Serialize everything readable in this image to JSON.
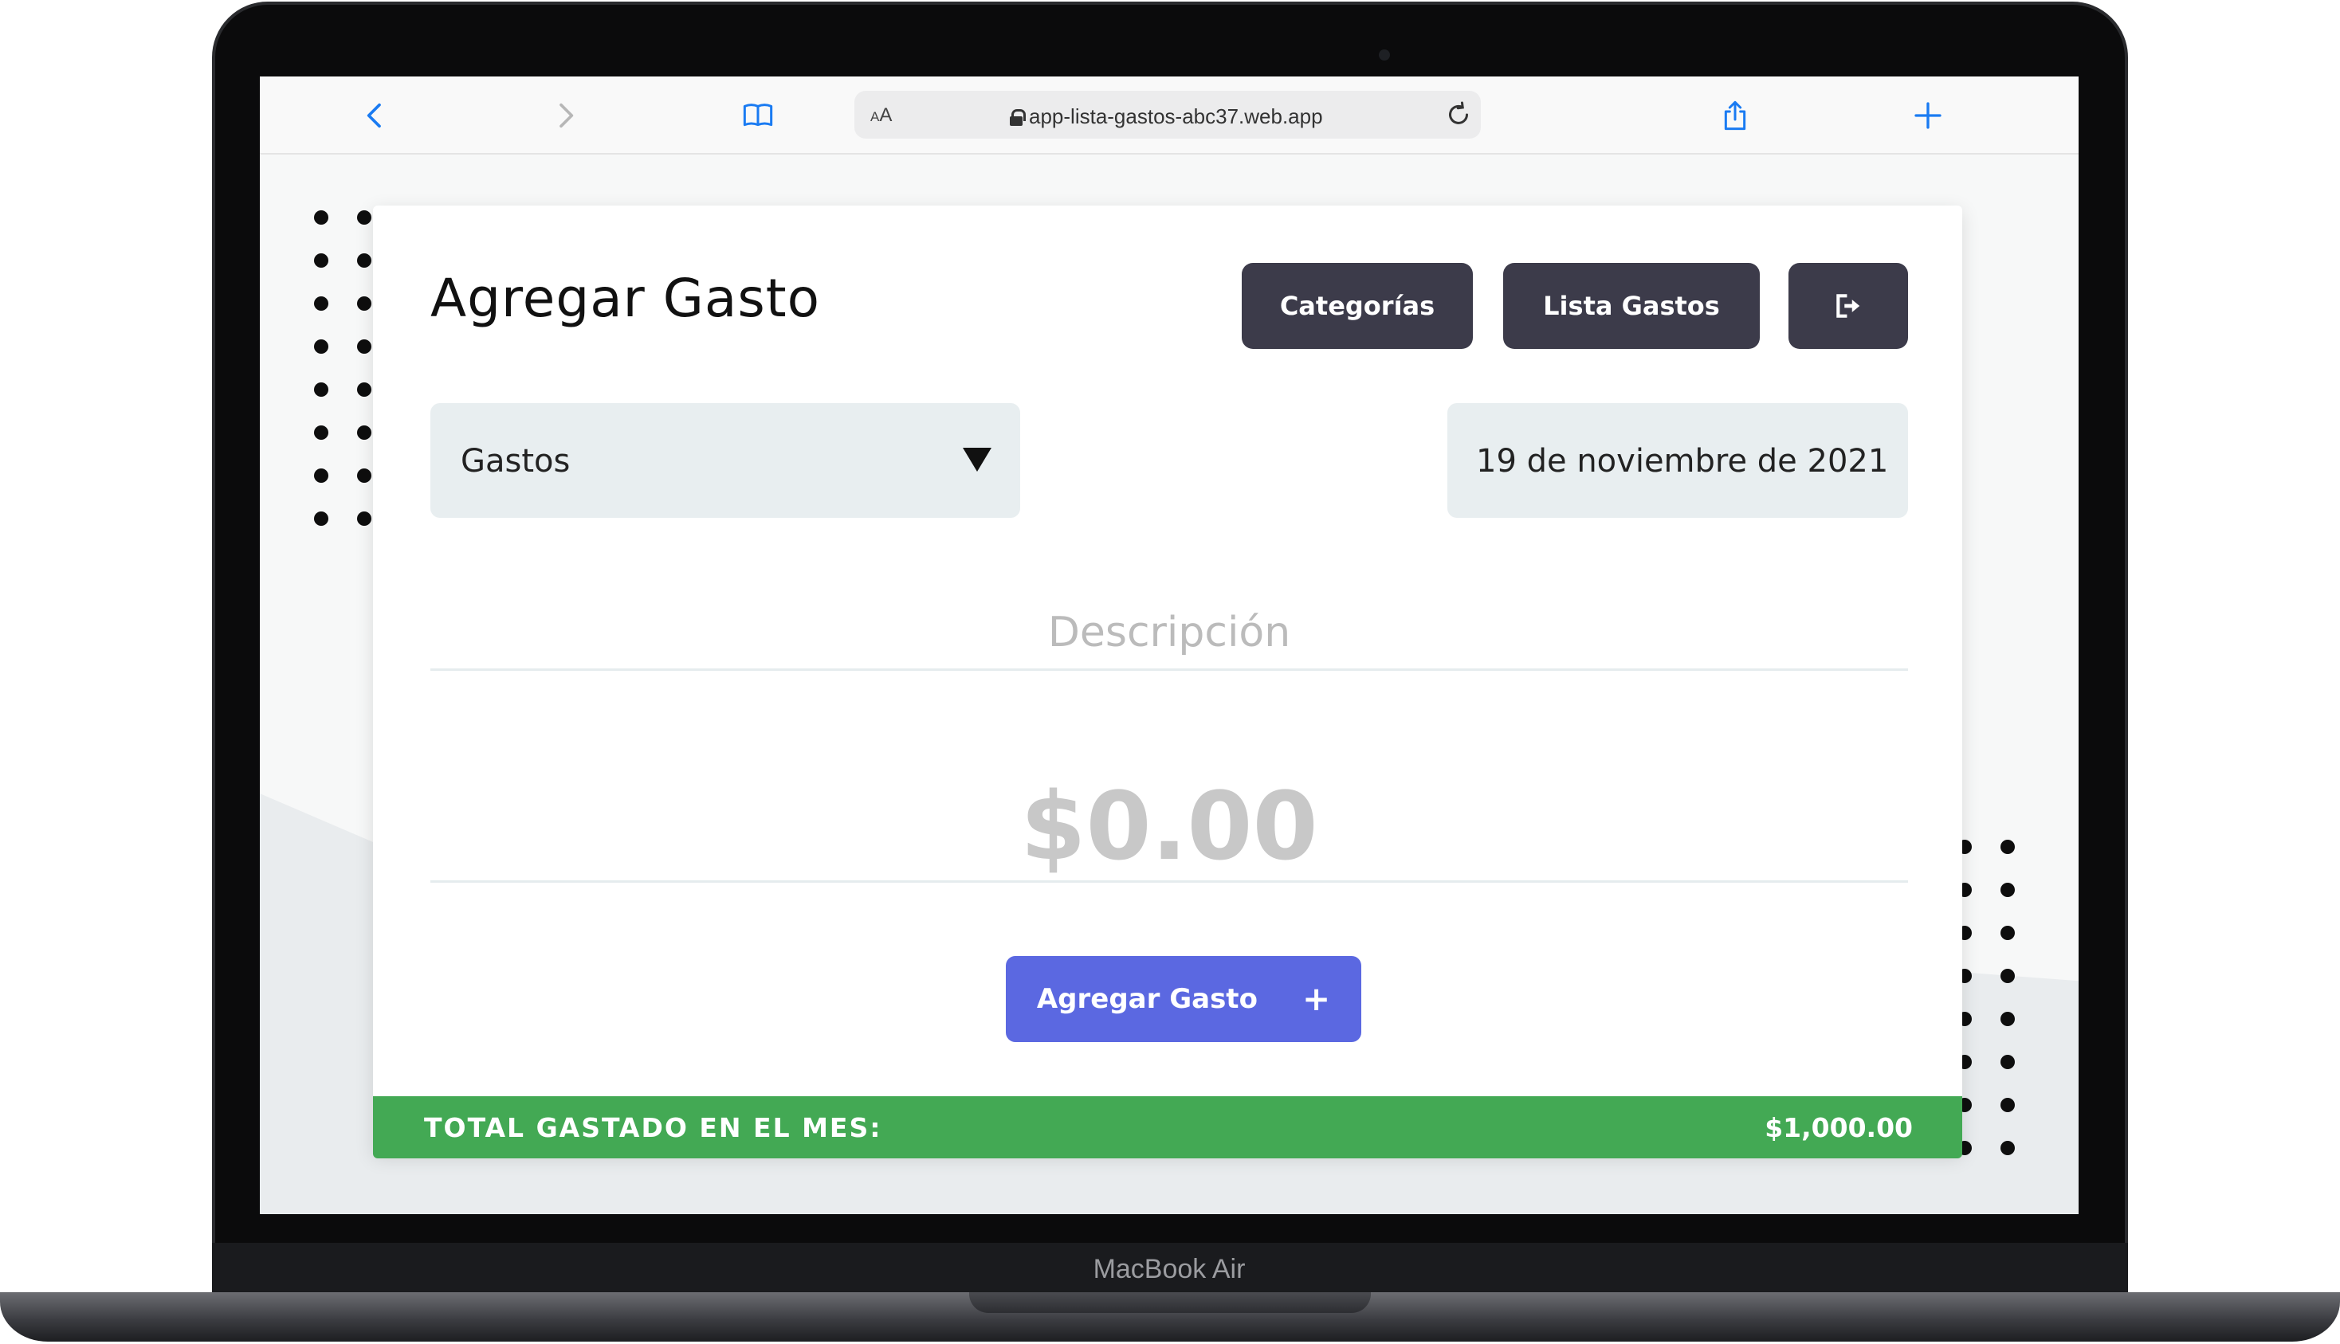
{
  "device": {
    "model_label": "MacBook Air"
  },
  "browser": {
    "url_prefix": "AA",
    "url": "app-lista-gastos-abc37.web.app"
  },
  "header": {
    "title": "Agregar Gasto",
    "buttons": {
      "categories": "Categorías",
      "expense_list": "Lista Gastos"
    }
  },
  "form": {
    "category_select": {
      "selected": "Gastos"
    },
    "date": "19 de noviembre de 2021",
    "description": {
      "placeholder": "Descripción",
      "value": ""
    },
    "amount": {
      "placeholder": "$0.00",
      "value": ""
    },
    "submit_label": "Agregar Gasto",
    "submit_icon": "+"
  },
  "footer": {
    "total_label": "TOTAL GASTADO EN EL MES:",
    "total_value": "$1,000.00"
  },
  "colors": {
    "dark_button": "#3c3b4a",
    "primary_button": "#5b68e1",
    "total_bar": "#43a954",
    "input_bg": "#e8eef0"
  }
}
